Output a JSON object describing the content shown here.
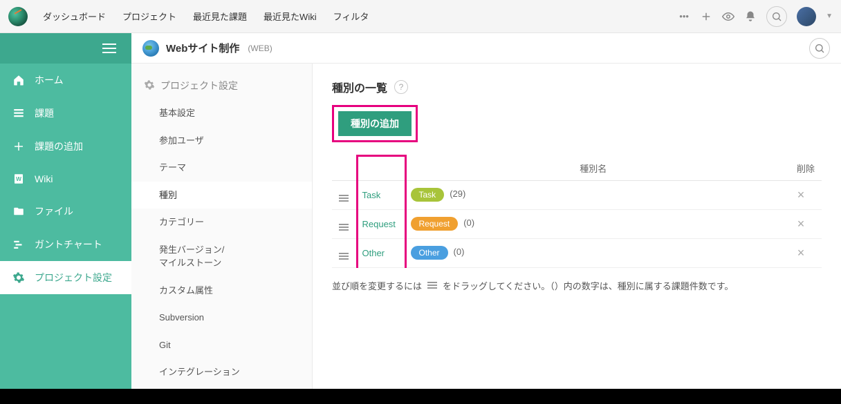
{
  "topnav": {
    "items": [
      "ダッシュボード",
      "プロジェクト",
      "最近見た課題",
      "最近見たWiki",
      "フィルタ"
    ]
  },
  "leftnav": {
    "items": [
      {
        "label": "ホーム",
        "icon": "home"
      },
      {
        "label": "課題",
        "icon": "list"
      },
      {
        "label": "課題の追加",
        "icon": "plus"
      },
      {
        "label": "Wiki",
        "icon": "wiki"
      },
      {
        "label": "ファイル",
        "icon": "folder"
      },
      {
        "label": "ガントチャート",
        "icon": "gantt"
      },
      {
        "label": "プロジェクト設定",
        "icon": "gear",
        "active": true
      }
    ]
  },
  "project": {
    "title": "Webサイト制作",
    "key": "(WEB)"
  },
  "settings_menu": {
    "heading": "プロジェクト設定",
    "items": [
      "基本設定",
      "参加ユーザ",
      "テーマ",
      "種別",
      "カテゴリー",
      "発生バージョン/\nマイルストーン",
      "カスタム属性",
      "Subversion",
      "Git",
      "インテグレーション"
    ],
    "selected": "種別"
  },
  "content": {
    "title": "種別の一覧",
    "add_button": "種別の追加",
    "columns": {
      "name": "種別名",
      "delete": "削除"
    },
    "rows": [
      {
        "name": "Task",
        "badge": "Task",
        "badge_color": "#a8c43a",
        "count": "(29)"
      },
      {
        "name": "Request",
        "badge": "Request",
        "badge_color": "#f0a030",
        "count": "(0)"
      },
      {
        "name": "Other",
        "badge": "Other",
        "badge_color": "#4a9fe0",
        "count": "(0)"
      }
    ],
    "hint_prefix": "並び順を変更するには",
    "hint_suffix": "をドラッグしてください。（）内の数字は、種別に属する課題件数です。"
  }
}
